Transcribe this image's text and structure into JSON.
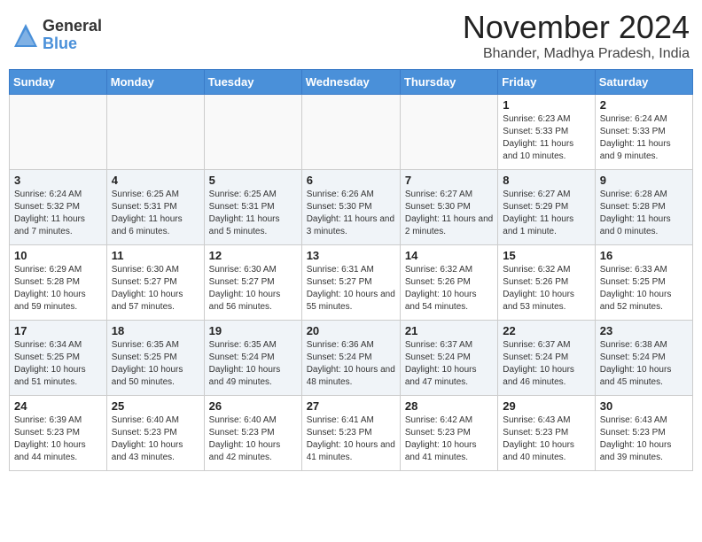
{
  "logo": {
    "general": "General",
    "blue": "Blue"
  },
  "title": "November 2024",
  "location": "Bhander, Madhya Pradesh, India",
  "days_of_week": [
    "Sunday",
    "Monday",
    "Tuesday",
    "Wednesday",
    "Thursday",
    "Friday",
    "Saturday"
  ],
  "weeks": [
    [
      {
        "day": "",
        "info": ""
      },
      {
        "day": "",
        "info": ""
      },
      {
        "day": "",
        "info": ""
      },
      {
        "day": "",
        "info": ""
      },
      {
        "day": "",
        "info": ""
      },
      {
        "day": "1",
        "info": "Sunrise: 6:23 AM\nSunset: 5:33 PM\nDaylight: 11 hours and 10 minutes."
      },
      {
        "day": "2",
        "info": "Sunrise: 6:24 AM\nSunset: 5:33 PM\nDaylight: 11 hours and 9 minutes."
      }
    ],
    [
      {
        "day": "3",
        "info": "Sunrise: 6:24 AM\nSunset: 5:32 PM\nDaylight: 11 hours and 7 minutes."
      },
      {
        "day": "4",
        "info": "Sunrise: 6:25 AM\nSunset: 5:31 PM\nDaylight: 11 hours and 6 minutes."
      },
      {
        "day": "5",
        "info": "Sunrise: 6:25 AM\nSunset: 5:31 PM\nDaylight: 11 hours and 5 minutes."
      },
      {
        "day": "6",
        "info": "Sunrise: 6:26 AM\nSunset: 5:30 PM\nDaylight: 11 hours and 3 minutes."
      },
      {
        "day": "7",
        "info": "Sunrise: 6:27 AM\nSunset: 5:30 PM\nDaylight: 11 hours and 2 minutes."
      },
      {
        "day": "8",
        "info": "Sunrise: 6:27 AM\nSunset: 5:29 PM\nDaylight: 11 hours and 1 minute."
      },
      {
        "day": "9",
        "info": "Sunrise: 6:28 AM\nSunset: 5:28 PM\nDaylight: 11 hours and 0 minutes."
      }
    ],
    [
      {
        "day": "10",
        "info": "Sunrise: 6:29 AM\nSunset: 5:28 PM\nDaylight: 10 hours and 59 minutes."
      },
      {
        "day": "11",
        "info": "Sunrise: 6:30 AM\nSunset: 5:27 PM\nDaylight: 10 hours and 57 minutes."
      },
      {
        "day": "12",
        "info": "Sunrise: 6:30 AM\nSunset: 5:27 PM\nDaylight: 10 hours and 56 minutes."
      },
      {
        "day": "13",
        "info": "Sunrise: 6:31 AM\nSunset: 5:27 PM\nDaylight: 10 hours and 55 minutes."
      },
      {
        "day": "14",
        "info": "Sunrise: 6:32 AM\nSunset: 5:26 PM\nDaylight: 10 hours and 54 minutes."
      },
      {
        "day": "15",
        "info": "Sunrise: 6:32 AM\nSunset: 5:26 PM\nDaylight: 10 hours and 53 minutes."
      },
      {
        "day": "16",
        "info": "Sunrise: 6:33 AM\nSunset: 5:25 PM\nDaylight: 10 hours and 52 minutes."
      }
    ],
    [
      {
        "day": "17",
        "info": "Sunrise: 6:34 AM\nSunset: 5:25 PM\nDaylight: 10 hours and 51 minutes."
      },
      {
        "day": "18",
        "info": "Sunrise: 6:35 AM\nSunset: 5:25 PM\nDaylight: 10 hours and 50 minutes."
      },
      {
        "day": "19",
        "info": "Sunrise: 6:35 AM\nSunset: 5:24 PM\nDaylight: 10 hours and 49 minutes."
      },
      {
        "day": "20",
        "info": "Sunrise: 6:36 AM\nSunset: 5:24 PM\nDaylight: 10 hours and 48 minutes."
      },
      {
        "day": "21",
        "info": "Sunrise: 6:37 AM\nSunset: 5:24 PM\nDaylight: 10 hours and 47 minutes."
      },
      {
        "day": "22",
        "info": "Sunrise: 6:37 AM\nSunset: 5:24 PM\nDaylight: 10 hours and 46 minutes."
      },
      {
        "day": "23",
        "info": "Sunrise: 6:38 AM\nSunset: 5:24 PM\nDaylight: 10 hours and 45 minutes."
      }
    ],
    [
      {
        "day": "24",
        "info": "Sunrise: 6:39 AM\nSunset: 5:23 PM\nDaylight: 10 hours and 44 minutes."
      },
      {
        "day": "25",
        "info": "Sunrise: 6:40 AM\nSunset: 5:23 PM\nDaylight: 10 hours and 43 minutes."
      },
      {
        "day": "26",
        "info": "Sunrise: 6:40 AM\nSunset: 5:23 PM\nDaylight: 10 hours and 42 minutes."
      },
      {
        "day": "27",
        "info": "Sunrise: 6:41 AM\nSunset: 5:23 PM\nDaylight: 10 hours and 41 minutes."
      },
      {
        "day": "28",
        "info": "Sunrise: 6:42 AM\nSunset: 5:23 PM\nDaylight: 10 hours and 41 minutes."
      },
      {
        "day": "29",
        "info": "Sunrise: 6:43 AM\nSunset: 5:23 PM\nDaylight: 10 hours and 40 minutes."
      },
      {
        "day": "30",
        "info": "Sunrise: 6:43 AM\nSunset: 5:23 PM\nDaylight: 10 hours and 39 minutes."
      }
    ]
  ]
}
